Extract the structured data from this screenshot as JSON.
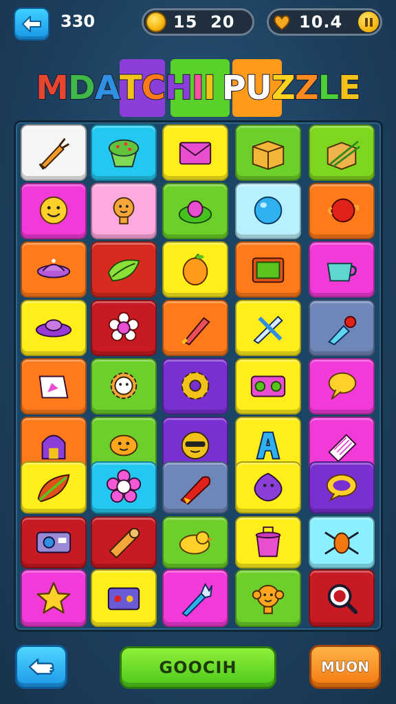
{
  "hud": {
    "score": "330",
    "coins": "15  20",
    "lives": "10.4"
  },
  "title": {
    "text": "MDATCHII PUZZLE",
    "letter_colors": [
      "#e8452f",
      "#3fb84a",
      "#2f8fe0",
      "#f2c21b",
      "#ff7a1a",
      "#8b3fd8",
      "#ff4fa0",
      "#f2c21b",
      "#ffffff",
      "#ffffff",
      "#ffd21f",
      "#ff8a1f",
      "#4ad13a",
      "#f2c21b",
      "#e8452f"
    ]
  },
  "colors": {
    "white": "#f5f5f5",
    "cyan": "#22c8f0",
    "yellow": "#ffee1a",
    "green": "#6ccf2a",
    "lime": "#7fd61e",
    "magenta": "#f23ad8",
    "pink": "#ffaadf",
    "ice": "#b8f0ff",
    "orange": "#ff7a1a",
    "red": "#d82a1e",
    "crimson": "#c71a22",
    "slate": "#6f86b8",
    "purple": "#7a2fd0",
    "mint": "#8bf0ff"
  },
  "board": {
    "rows": [
      [
        {
          "c": "white",
          "icon": "carrot-icon"
        },
        {
          "c": "cyan",
          "icon": "cupcake-icon"
        },
        {
          "c": "yellow",
          "icon": "envelope-icon"
        },
        {
          "c": "green",
          "icon": "box-icon"
        },
        {
          "c": "lime",
          "icon": "box-sticks-icon"
        }
      ],
      [
        {
          "c": "magenta",
          "icon": "smiley-face-icon"
        },
        {
          "c": "pink",
          "icon": "robot-bulb-icon"
        },
        {
          "c": "green",
          "icon": "egg-icon"
        },
        {
          "c": "ice",
          "icon": "balloon-icon"
        },
        {
          "c": "orange",
          "icon": "red-pot-icon"
        }
      ],
      [
        {
          "c": "orange",
          "icon": "ufo-bowl-icon"
        },
        {
          "c": "red",
          "icon": "leaf-icon"
        },
        {
          "c": "yellow",
          "icon": "orange-fruit-icon"
        },
        {
          "c": "orange",
          "icon": "picture-frame-icon"
        },
        {
          "c": "magenta",
          "icon": "teacup-icon"
        }
      ],
      [
        {
          "c": "yellow",
          "icon": "flying-saucer-icon"
        },
        {
          "c": "crimson",
          "icon": "flower-icon"
        },
        {
          "c": "orange",
          "icon": "marker-icon"
        },
        {
          "c": "yellow",
          "icon": "crossed-blades-icon"
        },
        {
          "c": "slate",
          "icon": "paintbrush-icon"
        }
      ],
      [
        {
          "c": "orange",
          "icon": "card-icon"
        },
        {
          "c": "green",
          "icon": "gear-face-icon"
        },
        {
          "c": "purple",
          "icon": "gear-icon"
        },
        {
          "c": "yellow",
          "icon": "radio-icon"
        },
        {
          "c": "magenta",
          "icon": "speech-bubble-icon"
        }
      ],
      [
        {
          "c": "orange",
          "icon": "arch-icon"
        },
        {
          "c": "green",
          "icon": "fish-face-icon"
        },
        {
          "c": "purple",
          "icon": "sun-mask-icon"
        },
        {
          "c": "yellow",
          "icon": "letter-a-icon"
        },
        {
          "c": "magenta",
          "icon": "eraser-icon"
        }
      ],
      [
        {
          "c": "yellow",
          "icon": "feather-leaf-icon"
        },
        {
          "c": "cyan",
          "icon": "donut-flower-icon"
        },
        {
          "c": "slate",
          "icon": "rocket-icon"
        },
        {
          "c": "yellow",
          "icon": "purple-blob-icon"
        },
        {
          "c": "purple",
          "icon": "ring-bubble-icon"
        }
      ],
      [
        {
          "c": "crimson",
          "icon": "camera-icon"
        },
        {
          "c": "crimson",
          "icon": "scroll-icon"
        },
        {
          "c": "green",
          "icon": "bird-icon"
        },
        {
          "c": "yellow",
          "icon": "pot-icon"
        },
        {
          "c": "mint",
          "icon": "bug-icon"
        }
      ],
      [
        {
          "c": "magenta",
          "icon": "star-icon"
        },
        {
          "c": "yellow",
          "icon": "gadget-box-icon"
        },
        {
          "c": "magenta",
          "icon": "wrench-icon"
        },
        {
          "c": "green",
          "icon": "monkey-icon"
        },
        {
          "c": "crimson",
          "icon": "magnifier-icon"
        }
      ]
    ]
  },
  "buttons": {
    "primary": "GOOCIH",
    "secondary": "MUON"
  }
}
